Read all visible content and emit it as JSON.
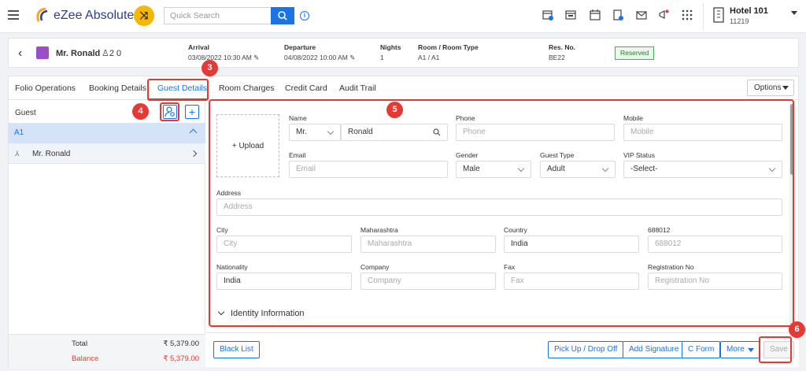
{
  "app": {
    "name": "eZee Absolute"
  },
  "search": {
    "placeholder": "Quick Search"
  },
  "hotel": {
    "name": "Hotel 101",
    "id": "11219"
  },
  "reservation": {
    "guest_name": "Mr. Ronald",
    "pax": "2  0",
    "arrival_label": "Arrival",
    "arrival_value": "03/08/2022 10:30 AM",
    "departure_label": "Departure",
    "departure_value": "04/08/2022 10:00 AM",
    "nights_label": "Nights",
    "nights_value": "1",
    "room_label": "Room / Room Type",
    "room_value": "A1 / A1",
    "resno_label": "Res. No.",
    "resno_value": "BE22",
    "status": "Reserved"
  },
  "tabs": [
    {
      "label": "Folio Operations"
    },
    {
      "label": "Booking Details"
    },
    {
      "label": "Guest Details"
    },
    {
      "label": "Room Charges"
    },
    {
      "label": "Credit Card"
    },
    {
      "label": "Audit Trail"
    }
  ],
  "options_label": "Options",
  "sidebar": {
    "title": "Guest",
    "room": "A1",
    "guest": "Mr. Ronald",
    "total_label": "Total",
    "total_value": "₹ 5,379.00",
    "balance_label": "Balance",
    "balance_value": "₹ 5,379.00"
  },
  "form": {
    "upload_label": "+ Upload",
    "name_label": "Name",
    "salutation": "Mr.",
    "name_value": "Ronald",
    "phone_label": "Phone",
    "phone_placeholder": "Phone",
    "mobile_label": "Mobile",
    "mobile_placeholder": "Mobile",
    "email_label": "Email",
    "email_placeholder": "Email",
    "gender_label": "Gender",
    "gender_value": "Male",
    "guest_type_label": "Guest Type",
    "guest_type_value": "Adult",
    "vip_label": "VIP Status",
    "vip_value": "-Select-",
    "address_label": "Address",
    "address_placeholder": "Address",
    "city_label": "City",
    "city_placeholder": "City",
    "state_label": "Maharashtra",
    "state_placeholder": "Maharashtra",
    "country_label": "Country",
    "country_value": "India",
    "zip_label": "688012",
    "zip_placeholder": "688012",
    "nationality_label": "Nationality",
    "nationality_value": "India",
    "company_label": "Company",
    "company_placeholder": "Company",
    "fax_label": "Fax",
    "fax_placeholder": "Fax",
    "regno_label": "Registration No",
    "regno_placeholder": "Registration No",
    "identity_section": "Identity Information"
  },
  "footer": {
    "blacklist": "Black List",
    "pickup": "Pick Up / Drop Off",
    "signature": "Add Signature",
    "cform": "C Form",
    "more": "More",
    "save": "Save"
  },
  "markers": [
    "3",
    "4",
    "5",
    "6"
  ],
  "colors": {
    "accent": "#1b73e8",
    "highlight": "#e53935",
    "brand": "#2e3f8e",
    "reserved": "#4caf50"
  }
}
